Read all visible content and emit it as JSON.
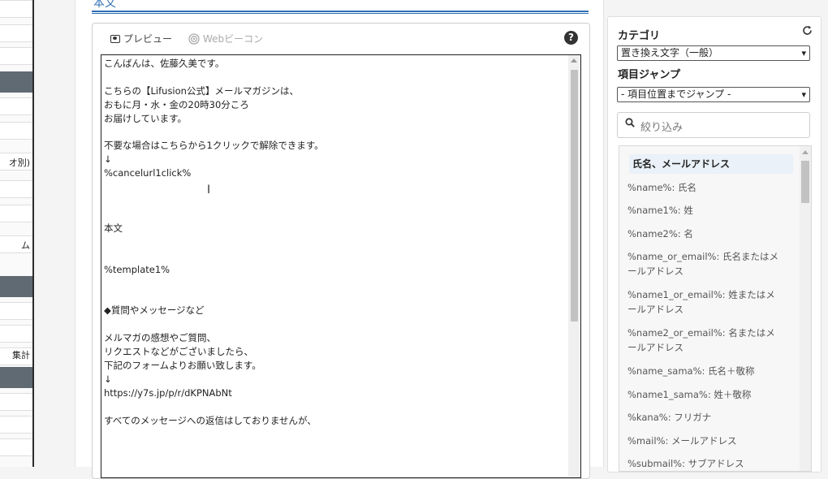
{
  "sidebar": {
    "labels": [
      "オ別)",
      "ム",
      "集計"
    ]
  },
  "editor": {
    "section_title": "本文",
    "tabs": [
      {
        "label": "プレビュー",
        "icon": "preview-icon"
      },
      {
        "label": "Webビーコン",
        "icon": "beacon-icon"
      }
    ],
    "help_glyph": "?",
    "body": "こんばんは、佐藤久美です。\n\nこちらの【Lifusion公式】メールマガジンは、\nおもに月・水・金の20時30分ころ\nお届けしています。\n\n不要な場合はこちらから1クリックで解除できます。\n↓\n%cancelurl1click%\n\n\n\n本文\n\n\n%template1%\n\n\n◆質問やメッセージなど\n\nメルマガの感想やご質問、\nリクエストなどがございましたら、\n下記のフォームよりお願い致します。\n↓\nhttps://y7s.jp/p/r/dKPNAbNt\n\nすべてのメッセージへの返信はしておりませんが、"
  },
  "panel": {
    "category_label": "カテゴリ",
    "category_value": "置き換え文字（一般）",
    "jump_label": "項目ジャンプ",
    "jump_value": "- 項目位置までジャンプ -",
    "filter_placeholder": "絞り込み",
    "list_header": "氏名、メールアドレス",
    "items": [
      "%name%: 氏名",
      "%name1%: 姓",
      "%name2%: 名",
      "%name_or_email%: 氏名またはメ\nールアドレス",
      "%name1_or_email%: 姓またはメ\nールアドレス",
      "%name2_or_email%: 名またはメ\nールアドレス",
      "%name_sama%: 氏名＋敬称",
      "%name1_sama%: 姓＋敬称",
      "%kana%: フリガナ",
      "%mail%: メールアドレス",
      "%submail%: サブアドレス"
    ]
  },
  "colors": {
    "accent": "#2e6fb3",
    "sidebar_dark": "#5f6a73"
  }
}
